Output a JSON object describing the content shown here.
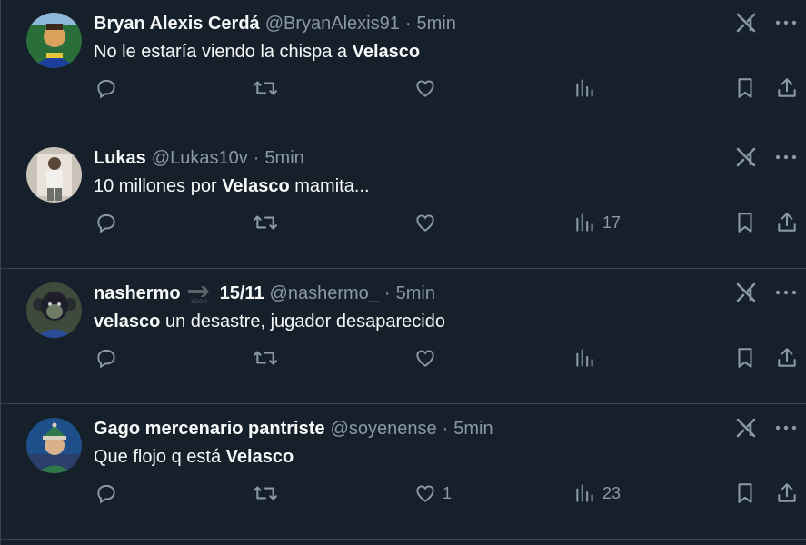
{
  "tweets": [
    {
      "name": "Bryan Alexis Cerdá",
      "handle": "@BryanAlexis91",
      "dot": "·",
      "time": "5min",
      "text_before": "No le estaría viendo la chispa a ",
      "text_bold": "Velasco",
      "text_after": "",
      "likes": "",
      "views": "",
      "avatar_colors": [
        "#2a6e3a",
        "#d9a35e",
        "#1d3f9c"
      ]
    },
    {
      "name": "Lukas",
      "handle": "@Lukas10v",
      "dot": "·",
      "time": "5min",
      "text_before": "10 millones por ",
      "text_bold": "Velasco",
      "text_after": " mamita...",
      "likes": "",
      "views": "17",
      "avatar_colors": [
        "#c9c2b8",
        "#e8e2da",
        "#6d6f6a"
      ]
    },
    {
      "name": "nashermo",
      "badge": "15/11",
      "badge_small": "SOON",
      "handle": "@nashermo_",
      "dot": "·",
      "time": "5min",
      "text_before": "",
      "text_bold": "velasco",
      "text_after": " un desastre, jugador desaparecido",
      "likes": "",
      "views": "",
      "avatar_colors": [
        "#3e4a3c",
        "#1e1f2a",
        "#6f7c66"
      ]
    },
    {
      "name": "Gago mercenario pantriste",
      "handle": "@soyenense",
      "dot": "·",
      "time": "5min",
      "text_before": "Que flojo q está ",
      "text_bold": "Velasco",
      "text_after": "",
      "likes": "1",
      "views": "23",
      "avatar_colors": [
        "#1f4f8a",
        "#2f7a48",
        "#d8d0c0"
      ]
    }
  ],
  "icons": {
    "reply": "reply-icon",
    "retweet": "retweet-icon",
    "like": "heart-icon",
    "views": "views-icon",
    "bookmark": "bookmark-icon",
    "share": "share-icon",
    "grok": "grok-icon",
    "more": "more-icon"
  },
  "colors": {
    "background": "#15202b",
    "divider": "#38444d",
    "text": "#f7f9f9",
    "secondary": "#8b98a5"
  }
}
